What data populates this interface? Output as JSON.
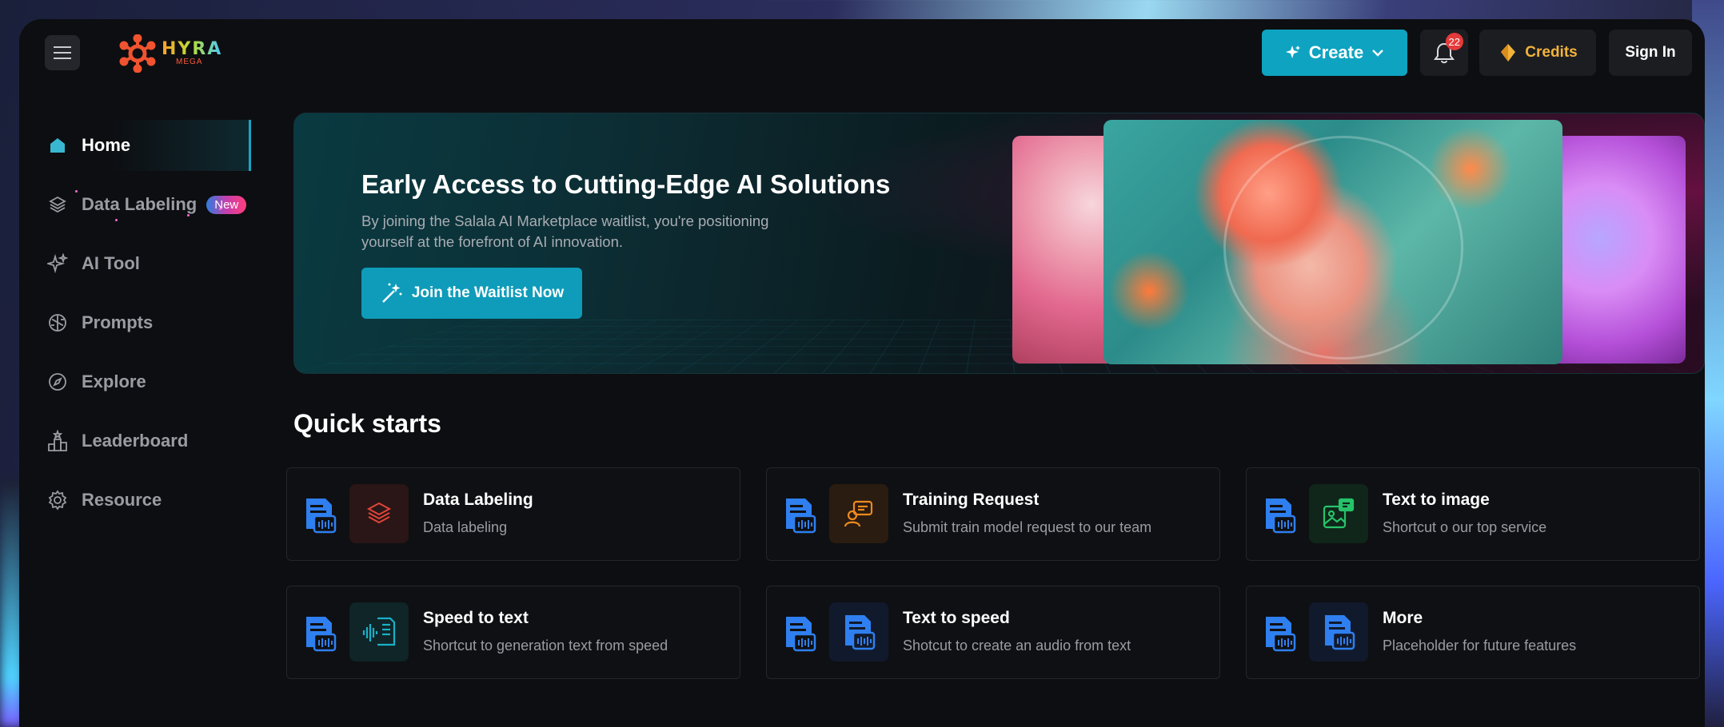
{
  "brand": {
    "name": "HYRA",
    "sub": "MEGA"
  },
  "header": {
    "create_label": "Create",
    "notification_count": "22",
    "credits_label": "Credits",
    "signin_label": "Sign In"
  },
  "sidebar": {
    "items": [
      {
        "label": "Home",
        "icon": "home-icon",
        "active": true
      },
      {
        "label": "Data Labeling",
        "icon": "layers-icon",
        "badge": "New"
      },
      {
        "label": "AI Tool",
        "icon": "sparkles-icon"
      },
      {
        "label": "Prompts",
        "icon": "brain-icon"
      },
      {
        "label": "Explore",
        "icon": "compass-icon"
      },
      {
        "label": "Leaderboard",
        "icon": "podium-icon"
      },
      {
        "label": "Resource",
        "icon": "gear-icon"
      }
    ]
  },
  "banner": {
    "title": "Early Access to Cutting-Edge AI Solutions",
    "description": "By joining the Salala AI Marketplace waitlist, you're positioning yourself at the forefront of AI innovation.",
    "cta_label": "Join the Waitlist Now"
  },
  "quick_starts": {
    "title": "Quick starts",
    "cards": [
      {
        "title": "Data Labeling",
        "desc": "Data labeling",
        "icon": "stack-icon",
        "color": "#e0453a"
      },
      {
        "title": "Training Request",
        "desc": "Submit train model request to our team",
        "icon": "chat-user-icon",
        "color": "#f0891e"
      },
      {
        "title": "Text to image",
        "desc": "Shortcut o our top service",
        "icon": "image-icon",
        "color": "#26c36a"
      },
      {
        "title": "Speed to text",
        "desc": "Shortcut to generation text from speed",
        "icon": "waveform-doc-icon",
        "color": "#1ab0c6"
      },
      {
        "title": "Text to speed",
        "desc": "Shotcut to create an audio from text",
        "icon": "audio-doc-icon",
        "color": "#2f7ff0"
      },
      {
        "title": "More",
        "desc": "Placeholder for future features",
        "icon": "audio-doc-icon",
        "color": "#2f7ff0"
      }
    ]
  },
  "colors": {
    "accent": "#0ea3c1",
    "credits": "#f2b33b",
    "badge": "#e53a3a"
  }
}
